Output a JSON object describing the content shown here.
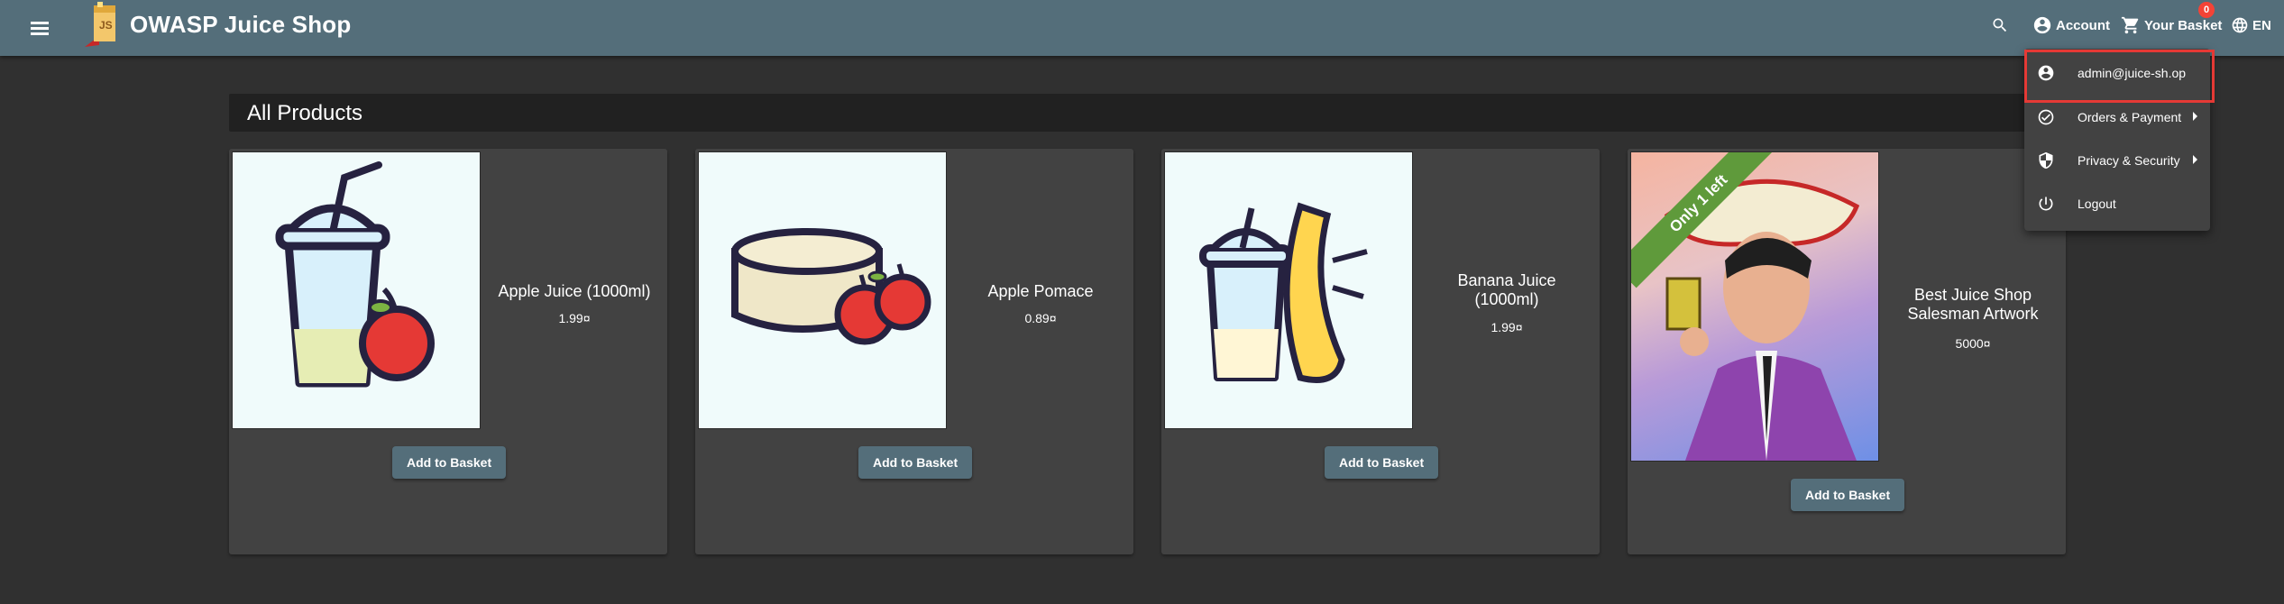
{
  "toolbar": {
    "app_title": "OWASP Juice Shop",
    "menu_icon": "menu-icon",
    "search_icon": "search-icon",
    "account_label": "Account",
    "basket_label": "Your Basket",
    "basket_count": "0",
    "language_label": "EN",
    "colors": {
      "toolbar": "#546e7a",
      "badge": "#f44336"
    }
  },
  "main": {
    "heading": "All Products",
    "products": [
      {
        "name": "Apple Juice (1000ml)",
        "price": "1.99¤",
        "button": "Add to Basket"
      },
      {
        "name": "Apple Pomace",
        "price": "0.89¤",
        "button": "Add to Basket"
      },
      {
        "name": "Banana Juice (1000ml)",
        "price": "1.99¤",
        "button": "Add to Basket"
      },
      {
        "name": "Best Juice Shop Salesman Artwork",
        "price": "5000¤",
        "button": "Add to Basket",
        "ribbon": "Only 1 left"
      }
    ]
  },
  "account_menu": {
    "items": [
      {
        "label": "admin@juice-sh.op",
        "icon": "account-circle-icon",
        "submenu": false
      },
      {
        "label": "Orders & Payment",
        "icon": "check-circle-icon",
        "submenu": true
      },
      {
        "label": "Privacy & Security",
        "icon": "shield-icon",
        "submenu": true
      },
      {
        "label": "Logout",
        "icon": "power-icon",
        "submenu": false
      }
    ],
    "highlight_color": "#e53935"
  }
}
